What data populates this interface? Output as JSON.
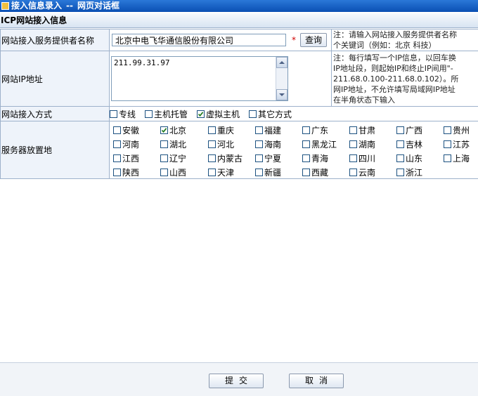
{
  "window": {
    "title_part1": "接入信息录入",
    "separator": "--",
    "title_part2": "网页对话框"
  },
  "section": {
    "title": "ICP网站接入信息"
  },
  "provider": {
    "label": "网站接入服务提供者名称",
    "value": "北京中电飞华通信股份有限公司",
    "required_mark": "*",
    "query_button": "查询",
    "note_line1": "注：请输入网站接入服务提供者名称",
    "note_line2": "个关键词（例如：北京 科技）"
  },
  "ip": {
    "label": "网站IP地址",
    "value": "211.99.31.97",
    "note_lines": [
      "注：每行填写一个IP信息，以回车换",
      "IP地址段，则起始IP和终止IP间用\"-",
      "211.68.0.100-211.68.0.102）。所",
      "网IP地址，不允许填写局域网IP地址",
      "在半角状态下输入"
    ]
  },
  "access_method": {
    "label": "网站接入方式",
    "options": [
      {
        "label": "专线",
        "checked": false
      },
      {
        "label": "主机托管",
        "checked": false
      },
      {
        "label": "虚拟主机",
        "checked": true
      },
      {
        "label": "其它方式",
        "checked": false
      }
    ]
  },
  "server_location": {
    "label": "服务器放置地",
    "options": [
      {
        "label": "安徽",
        "checked": false
      },
      {
        "label": "北京",
        "checked": true
      },
      {
        "label": "重庆",
        "checked": false
      },
      {
        "label": "福建",
        "checked": false
      },
      {
        "label": "广东",
        "checked": false
      },
      {
        "label": "甘肃",
        "checked": false
      },
      {
        "label": "广西",
        "checked": false
      },
      {
        "label": "贵州",
        "checked": false
      },
      {
        "label": "河南",
        "checked": false
      },
      {
        "label": "湖北",
        "checked": false
      },
      {
        "label": "河北",
        "checked": false
      },
      {
        "label": "海南",
        "checked": false
      },
      {
        "label": "黑龙江",
        "checked": false
      },
      {
        "label": "湖南",
        "checked": false
      },
      {
        "label": "吉林",
        "checked": false
      },
      {
        "label": "江苏",
        "checked": false
      },
      {
        "label": "江西",
        "checked": false
      },
      {
        "label": "辽宁",
        "checked": false
      },
      {
        "label": "内蒙古",
        "checked": false
      },
      {
        "label": "宁夏",
        "checked": false
      },
      {
        "label": "青海",
        "checked": false
      },
      {
        "label": "四川",
        "checked": false
      },
      {
        "label": "山东",
        "checked": false
      },
      {
        "label": "上海",
        "checked": false
      },
      {
        "label": "陕西",
        "checked": false
      },
      {
        "label": "山西",
        "checked": false
      },
      {
        "label": "天津",
        "checked": false
      },
      {
        "label": "新疆",
        "checked": false
      },
      {
        "label": "西藏",
        "checked": false
      },
      {
        "label": "云南",
        "checked": false
      },
      {
        "label": "浙江",
        "checked": false
      }
    ]
  },
  "footer": {
    "submit": "提交",
    "cancel": "取消"
  }
}
